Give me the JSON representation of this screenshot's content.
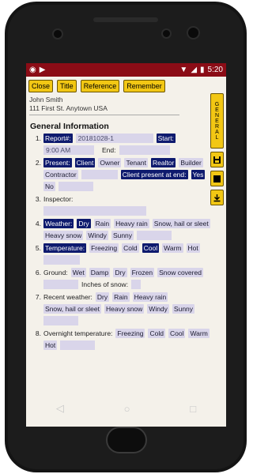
{
  "status": {
    "time": "5:20"
  },
  "toolbar": {
    "close": "Close",
    "title": "Title",
    "reference": "Reference",
    "remember": "Remember"
  },
  "client": {
    "name": "John Smith",
    "address": "111 First St. Anytown USA"
  },
  "side": {
    "general": "GENERAL"
  },
  "section": "General Information",
  "q1": {
    "num": "1.",
    "report_label": "Report#:",
    "report_value": "20181028-1",
    "start_label": "Start:",
    "start_value": "9:00 AM",
    "end_label": "End:"
  },
  "q2": {
    "num": "2.",
    "label": "Present:",
    "options": [
      "Client",
      "Owner",
      "Tenant",
      "Realtor",
      "Builder",
      "Contractor"
    ],
    "present_end": "Client present at end:",
    "yes": "Yes",
    "no": "No"
  },
  "q3": {
    "num": "3.",
    "label": "Inspector:"
  },
  "q4": {
    "num": "4.",
    "label": "Weather:",
    "options": [
      "Dry",
      "Rain",
      "Heavy rain",
      "Snow, hail or sleet",
      "Heavy snow",
      "Windy",
      "Sunny"
    ]
  },
  "q5": {
    "num": "5.",
    "label": "Temperature:",
    "options": [
      "Freezing",
      "Cold",
      "Cool",
      "Warm",
      "Hot"
    ]
  },
  "q6": {
    "num": "6.",
    "label": "Ground:",
    "options": [
      "Wet",
      "Damp",
      "Dry",
      "Frozen",
      "Snow covered"
    ],
    "inches": "Inches of snow:"
  },
  "q7": {
    "num": "7.",
    "label": "Recent weather:",
    "options": [
      "Dry",
      "Rain",
      "Heavy rain",
      "Snow, hail or sleet",
      "Heavy snow",
      "Windy",
      "Sunny"
    ]
  },
  "q8": {
    "num": "8.",
    "label": "Overnight temperature:",
    "options": [
      "Freezing",
      "Cold",
      "Cool",
      "Warm",
      "Hot"
    ]
  }
}
